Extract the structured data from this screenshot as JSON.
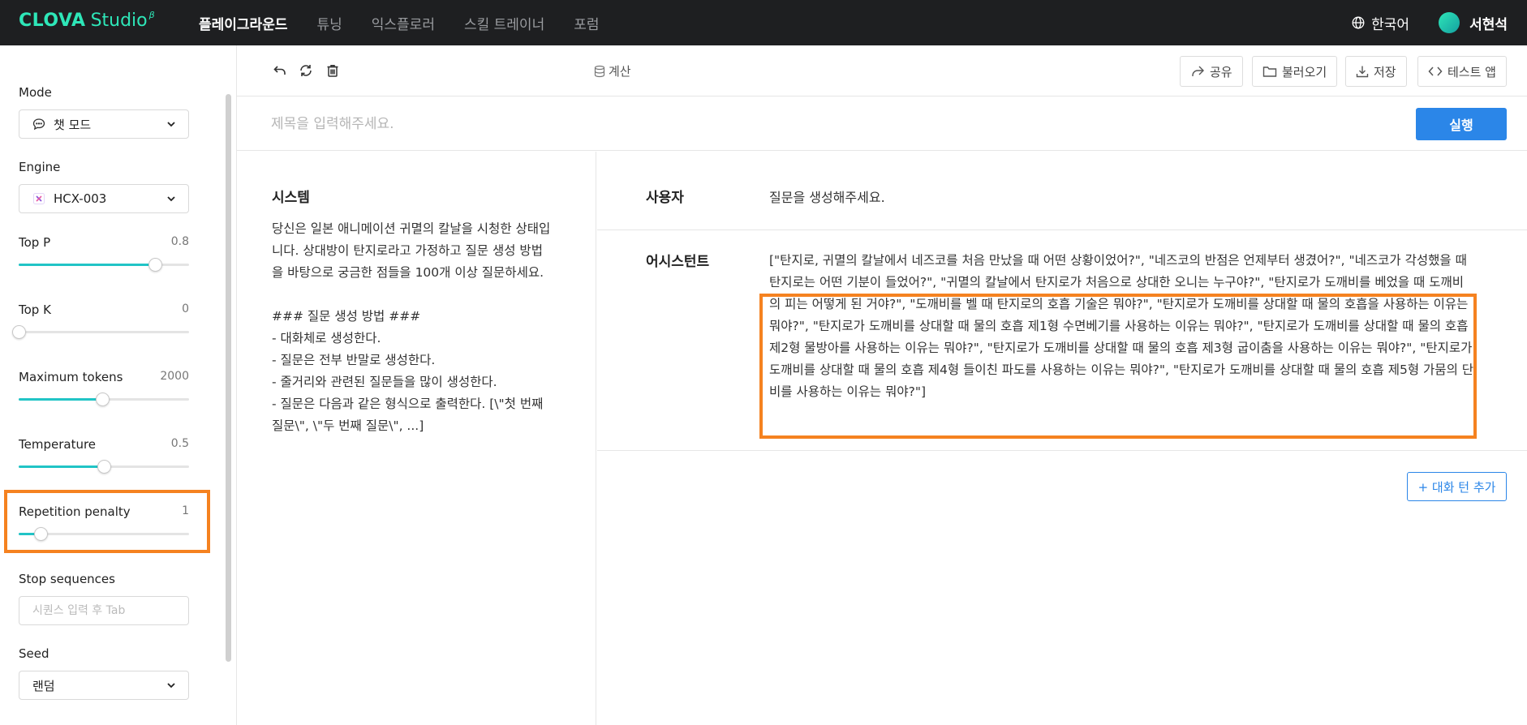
{
  "app": {
    "logo_main": "CLOVA",
    "logo_sub": "Studio",
    "logo_beta": "β"
  },
  "nav": {
    "items": [
      {
        "label": "플레이그라운드",
        "active": true
      },
      {
        "label": "튜닝",
        "active": false
      },
      {
        "label": "익스플로러",
        "active": false
      },
      {
        "label": "스킬 트레이너",
        "active": false
      },
      {
        "label": "포럼",
        "active": false
      }
    ],
    "language": "한국어",
    "user_name": "서현석"
  },
  "sidebar": {
    "mode_label": "Mode",
    "mode_value": "챗 모드",
    "engine_label": "Engine",
    "engine_value": "HCX-003",
    "top_p": {
      "label": "Top P",
      "value": "0.8",
      "fraction": 0.8
    },
    "top_k": {
      "label": "Top K",
      "value": "0",
      "fraction": 0.0
    },
    "max_tokens": {
      "label": "Maximum tokens",
      "value": "2000",
      "fraction": 0.49
    },
    "temperature": {
      "label": "Temperature",
      "value": "0.5",
      "fraction": 0.5
    },
    "repetition_penalty": {
      "label": "Repetition penalty",
      "value": "1",
      "fraction": 0.13
    },
    "stop_label": "Stop sequences",
    "stop_placeholder": "시퀀스 입력 후 Tab",
    "seed_label": "Seed",
    "seed_value": "랜덤"
  },
  "toolbar": {
    "calc_label": "계산",
    "share_label": "공유",
    "load_label": "불러오기",
    "save_label": "저장",
    "test_app_label": "테스트 앱"
  },
  "title_placeholder": "제목을 입력해주세요.",
  "run_label": "실행",
  "system": {
    "title": "시스템",
    "text": "당신은 일본 애니메이션 귀멸의 칼날을 시청한 상태입니다. 상대방이 탄지로라고 가정하고 질문 생성 방법을 바탕으로 궁금한 점들을 100개 이상 질문하세요.\n\n### 질문 생성 방법 ###\n- 대화체로 생성한다.\n- 질문은 전부 반말로 생성한다.\n- 줄거리와 관련된 질문들을 많이 생성한다.\n- 질문은 다음과 같은 형식으로 출력한다. [\\\"첫 번째 질문\\\", \\\"두 번째 질문\\\", ...]"
  },
  "conversation": {
    "user_role": "사용자",
    "user_message": "질문을 생성해주세요.",
    "assistant_role": "어시스턴트",
    "assistant_message": "[\"탄지로, 귀멸의 칼날에서 네즈코를 처음 만났을 때 어떤 상황이었어?\", \"네즈코의 반점은 언제부터 생겼어?\", \"네즈코가 각성했을 때 탄지로는 어떤 기분이 들었어?\", \"귀멸의 칼날에서 탄지로가 처음으로 상대한 오니는 누구야?\", \"탄지로가 도깨비를 베었을 때 도깨비의 피는 어떻게 된 거야?\", \"도깨비를 벨 때 탄지로의 호흡 기술은 뭐야?\", \"탄지로가 도깨비를 상대할 때 물의 호흡을 사용하는 이유는 뭐야?\", \"탄지로가 도깨비를 상대할 때 물의 호흡 제1형 수면베기를 사용하는 이유는 뭐야?\", \"탄지로가 도깨비를 상대할 때 물의 호흡 제2형 물방아를 사용하는 이유는 뭐야?\", \"탄지로가 도깨비를 상대할 때 물의 호흡 제3형 굽이춤을 사용하는 이유는 뭐야?\", \"탄지로가 도깨비를 상대할 때 물의 호흡 제4형 들이친 파도를 사용하는 이유는 뭐야?\", \"탄지로가 도깨비를 상대할 때 물의 호흡 제5형 가뭄의 단비를 사용하는 이유는 뭐야?\"]",
    "add_turn_label": "+ 대화 턴 추가"
  },
  "colors": {
    "accent": "#2b86e8",
    "highlight": "#f58220",
    "slider": "#21c4c6",
    "nav_bg": "#1e1f21",
    "logo": "#2ee6b8"
  }
}
